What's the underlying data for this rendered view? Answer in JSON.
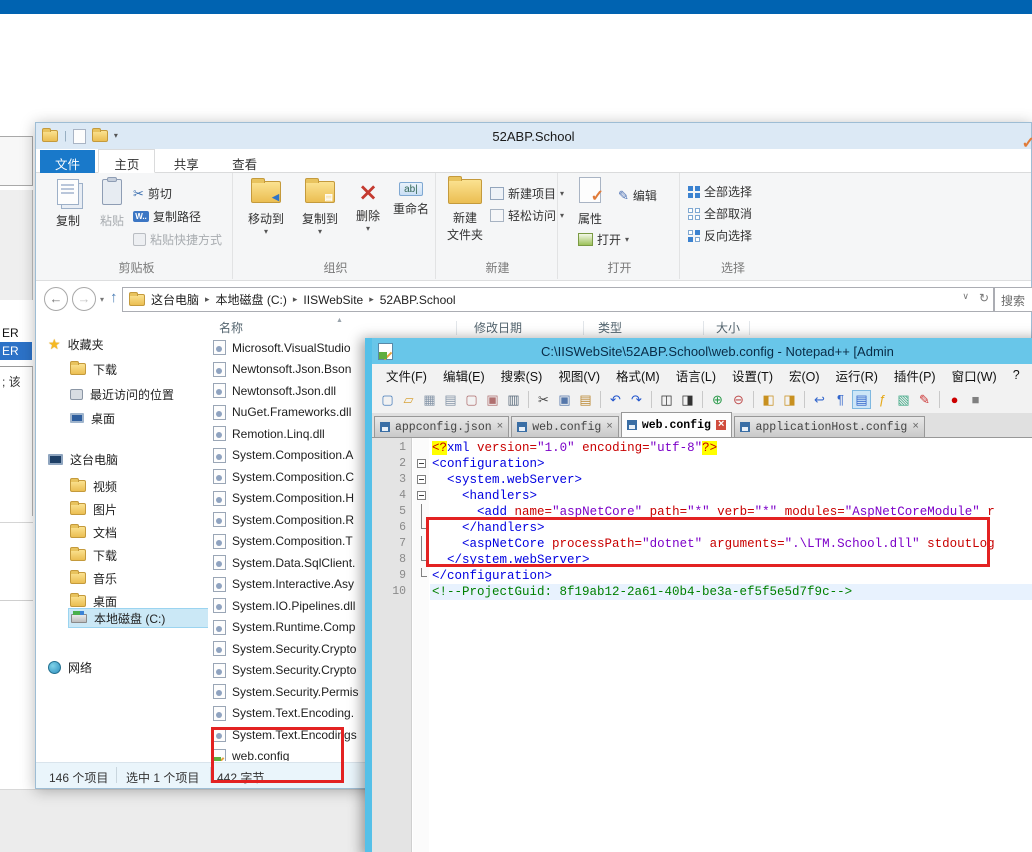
{
  "colors": {
    "top_bar": "#0063B1",
    "accent_red": "#E32222",
    "npp_titlebar": "#68C6E9"
  },
  "background": {
    "left_window": {
      "item_top": "ER",
      "item_selected": "ER",
      "note": "; 该"
    }
  },
  "explorer": {
    "title": "52ABP.School",
    "window_tabs": {
      "file": "文件",
      "home": "主页",
      "share": "共享",
      "view": "查看"
    },
    "ribbon": {
      "copy": "复制",
      "paste": "粘贴",
      "cut": "剪切",
      "copy_path": "复制路径",
      "paste_shortcut": "粘贴快捷方式",
      "clipboard_group": "剪贴板",
      "move_to": "移动到",
      "copy_to": "复制到",
      "delete": "删除",
      "rename": "重命名",
      "organize_group": "组织",
      "new_folder_line1": "新建",
      "new_folder_line2": "文件夹",
      "new_item": "新建项目",
      "easy_access": "轻松访问",
      "new_group": "新建",
      "properties": "属性",
      "open": "打开",
      "edit": "编辑",
      "open_group": "打开",
      "select_all": "全部选择",
      "select_none": "全部取消",
      "invert_selection": "反向选择",
      "select_group": "选择"
    },
    "address": {
      "breadcrumbs": [
        "这台电脑",
        "本地磁盘 (C:)",
        "IISWebSite",
        "52ABP.School"
      ],
      "search_text": "搜索"
    },
    "columns": [
      "名称",
      "修改日期",
      "类型",
      "大小"
    ],
    "nav": [
      {
        "label": "收藏夹",
        "icon": "star-icon",
        "children": [
          {
            "label": "下载",
            "icon": "folder-download-icon"
          },
          {
            "label": "最近访问的位置",
            "icon": "recent-places-icon"
          },
          {
            "label": "桌面",
            "icon": "desktop-icon"
          }
        ]
      },
      {
        "label": "这台电脑",
        "icon": "computer-icon",
        "children": [
          {
            "label": "视频",
            "icon": "folder-video-icon"
          },
          {
            "label": "图片",
            "icon": "folder-pictures-icon"
          },
          {
            "label": "文档",
            "icon": "folder-documents-icon"
          },
          {
            "label": "下载",
            "icon": "folder-download-icon"
          },
          {
            "label": "音乐",
            "icon": "folder-music-icon"
          },
          {
            "label": "桌面",
            "icon": "folder-desktop-icon"
          },
          {
            "label": "本地磁盘 (C:)",
            "icon": "drive-icon",
            "selected": true
          }
        ]
      },
      {
        "label": "网络",
        "icon": "network-icon",
        "children": []
      }
    ],
    "files": [
      {
        "name": "Microsoft.VisualStudio",
        "icon": "dll"
      },
      {
        "name": "Newtonsoft.Json.Bson",
        "icon": "dll"
      },
      {
        "name": "Newtonsoft.Json.dll",
        "icon": "dll"
      },
      {
        "name": "NuGet.Frameworks.dll",
        "icon": "dll"
      },
      {
        "name": "Remotion.Linq.dll",
        "icon": "dll"
      },
      {
        "name": "System.Composition.A",
        "icon": "dll"
      },
      {
        "name": "System.Composition.C",
        "icon": "dll"
      },
      {
        "name": "System.Composition.H",
        "icon": "dll"
      },
      {
        "name": "System.Composition.R",
        "icon": "dll"
      },
      {
        "name": "System.Composition.T",
        "icon": "dll"
      },
      {
        "name": "System.Data.SqlClient.",
        "icon": "dll"
      },
      {
        "name": "System.Interactive.Asy",
        "icon": "dll"
      },
      {
        "name": "System.IO.Pipelines.dll",
        "icon": "dll"
      },
      {
        "name": "System.Runtime.Comp",
        "icon": "dll"
      },
      {
        "name": "System.Security.Crypto",
        "icon": "dll"
      },
      {
        "name": "System.Security.Crypto",
        "icon": "dll"
      },
      {
        "name": "System.Security.Permis",
        "icon": "dll"
      },
      {
        "name": "System.Text.Encoding.",
        "icon": "dll"
      },
      {
        "name": "System.Text.Encodings",
        "icon": "dll"
      },
      {
        "name": "web.config",
        "icon": "config"
      }
    ],
    "status": {
      "items": "146 个项目",
      "selected": "选中 1 个项目",
      "size": "442 字节"
    }
  },
  "notepad": {
    "title": "C:\\IISWebSite\\52ABP.School\\web.config - Notepad++ [Admin",
    "menu": [
      "文件(F)",
      "编辑(E)",
      "搜索(S)",
      "视图(V)",
      "格式(M)",
      "语言(L)",
      "设置(T)",
      "宏(O)",
      "运行(R)",
      "插件(P)",
      "窗口(W)",
      "?"
    ],
    "toolbar": [
      {
        "name": "new-file-icon",
        "g": "▢",
        "c": "#4a7ebb"
      },
      {
        "name": "open-icon",
        "g": "▱",
        "c": "#d8a33a"
      },
      {
        "name": "save-icon",
        "g": "▦",
        "c": "#8595a8"
      },
      {
        "name": "save-all-icon",
        "g": "▤",
        "c": "#8595a8"
      },
      {
        "name": "close-icon",
        "g": "▢",
        "c": "#b07070"
      },
      {
        "name": "close-all-icon",
        "g": "▣",
        "c": "#b07070"
      },
      {
        "name": "print-icon",
        "g": "▥",
        "c": "#5a6b7c",
        "sep": true
      },
      {
        "name": "cut-icon",
        "g": "✂",
        "c": "#444444"
      },
      {
        "name": "copy-icon",
        "g": "▣",
        "c": "#5577aa"
      },
      {
        "name": "paste-icon",
        "g": "▤",
        "c": "#bb8833",
        "sep": true
      },
      {
        "name": "undo-icon",
        "g": "↶",
        "c": "#2255cc"
      },
      {
        "name": "redo-icon",
        "g": "↷",
        "c": "#2255cc",
        "sep": true
      },
      {
        "name": "find-icon",
        "g": "◫",
        "c": "#333333"
      },
      {
        "name": "replace-icon",
        "g": "◨",
        "c": "#333333",
        "sep": true
      },
      {
        "name": "zoom-in-icon",
        "g": "⊕",
        "c": "#2a9a4a"
      },
      {
        "name": "zoom-out-icon",
        "g": "⊖",
        "c": "#c05050",
        "sep": true
      },
      {
        "name": "sync-vertical-icon",
        "g": "◧",
        "c": "#c89020"
      },
      {
        "name": "sync-horizontal-icon",
        "g": "◨",
        "c": "#c89020",
        "sep": true
      },
      {
        "name": "word-wrap-icon",
        "g": "↩",
        "c": "#3366cc"
      },
      {
        "name": "show-symbols-icon",
        "g": "¶",
        "c": "#3366cc"
      },
      {
        "name": "indent-guide-icon",
        "g": "▤",
        "c": "#3366cc",
        "pressed": true
      },
      {
        "name": "function-list-icon",
        "g": "ƒ",
        "c": "#e6a817"
      },
      {
        "name": "doc-map-icon",
        "g": "▧",
        "c": "#44aa88"
      },
      {
        "name": "macro-icon",
        "g": "✎",
        "c": "#cc3333",
        "sep": true
      },
      {
        "name": "record-icon",
        "g": "●",
        "c": "#cc0000"
      },
      {
        "name": "stop-icon",
        "g": "■",
        "c": "#808080"
      }
    ],
    "tabs": [
      {
        "label": "appconfig.json"
      },
      {
        "label": "web.config"
      },
      {
        "label": "web.config",
        "active": true
      },
      {
        "label": "applicationHost.config"
      }
    ],
    "code": [
      {
        "n": 1,
        "fold": "",
        "tokens": [
          [
            "pi",
            "<?"
          ],
          [
            "tag",
            "xml"
          ],
          [
            "pl",
            " "
          ],
          [
            "attr",
            "version="
          ],
          [
            "val",
            "\"1.0\""
          ],
          [
            "pl",
            " "
          ],
          [
            "attr",
            "encoding="
          ],
          [
            "val",
            "\"utf-8\""
          ],
          [
            "pi",
            "?>"
          ]
        ]
      },
      {
        "n": 2,
        "fold": "box",
        "tokens": [
          [
            "tag",
            "<configuration>"
          ]
        ]
      },
      {
        "n": 3,
        "fold": "box",
        "tokens": [
          [
            "pl",
            "  "
          ],
          [
            "tag",
            "<system.webServer>"
          ]
        ]
      },
      {
        "n": 4,
        "fold": "box",
        "tokens": [
          [
            "pl",
            "    "
          ],
          [
            "tag",
            "<handlers>"
          ]
        ]
      },
      {
        "n": 5,
        "fold": "line",
        "tokens": [
          [
            "pl",
            "      "
          ],
          [
            "tag",
            "<add"
          ],
          [
            "pl",
            " "
          ],
          [
            "attr",
            "name="
          ],
          [
            "val",
            "\"aspNetCore\""
          ],
          [
            "pl",
            " "
          ],
          [
            "attr",
            "path="
          ],
          [
            "val",
            "\"*\""
          ],
          [
            "pl",
            " "
          ],
          [
            "attr",
            "verb="
          ],
          [
            "val",
            "\"*\""
          ],
          [
            "pl",
            " "
          ],
          [
            "attr",
            "modules="
          ],
          [
            "val",
            "\"AspNetCoreModule\""
          ],
          [
            "pl",
            " "
          ],
          [
            "attr",
            "r"
          ]
        ]
      },
      {
        "n": 6,
        "fold": "end",
        "tokens": [
          [
            "pl",
            "    "
          ],
          [
            "tag",
            "</handlers>"
          ]
        ]
      },
      {
        "n": 7,
        "fold": "line",
        "tokens": [
          [
            "pl",
            "    "
          ],
          [
            "tag",
            "<aspNetCore"
          ],
          [
            "pl",
            " "
          ],
          [
            "attr",
            "processPath="
          ],
          [
            "val",
            "\"dotnet\""
          ],
          [
            "pl",
            " "
          ],
          [
            "attr",
            "arguments="
          ],
          [
            "val",
            "\".\\LTM.School.dll\""
          ],
          [
            "pl",
            " "
          ],
          [
            "attr",
            "stdoutLog"
          ]
        ]
      },
      {
        "n": 8,
        "fold": "end",
        "tokens": [
          [
            "pl",
            "  "
          ],
          [
            "tag",
            "</system.webServer>"
          ]
        ]
      },
      {
        "n": 9,
        "fold": "end",
        "tokens": [
          [
            "tag",
            "</configuration>"
          ]
        ]
      },
      {
        "n": 10,
        "fold": "",
        "highlight": true,
        "tokens": [
          [
            "comment",
            "<!--ProjectGuid: 8f19ab12-2a61-40b4-be3a-ef5f5e5d7f9c-->"
          ]
        ]
      }
    ]
  }
}
